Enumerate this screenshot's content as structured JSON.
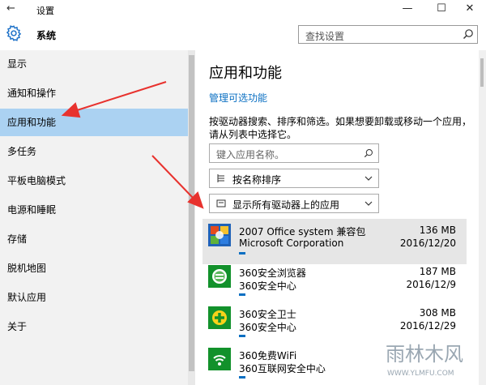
{
  "window": {
    "title": "设置",
    "back_glyph": "←",
    "minimize_glyph": "—",
    "maximize_glyph": "☐",
    "close_glyph": "✕"
  },
  "header": {
    "title": "系统",
    "search_placeholder": "查找设置"
  },
  "sidebar": {
    "items": [
      {
        "label": "显示"
      },
      {
        "label": "通知和操作"
      },
      {
        "label": "应用和功能",
        "selected": true
      },
      {
        "label": "多任务"
      },
      {
        "label": "平板电脑模式"
      },
      {
        "label": "电源和睡眠"
      },
      {
        "label": "存储"
      },
      {
        "label": "脱机地图"
      },
      {
        "label": "默认应用"
      },
      {
        "label": "关于"
      }
    ]
  },
  "main": {
    "title": "应用和功能",
    "manage_link": "管理可选功能",
    "description": "按驱动器搜索、排序和筛选。如果想要卸载或移动一个应用，请从列表中选择它。",
    "search_placeholder": "键入应用名称。",
    "sort_label": "按名称排序",
    "filter_label": "显示所有驱动器上的应用",
    "apps": [
      {
        "name": "2007 Office system 兼容包",
        "publisher": "Microsoft Corporation",
        "size": "136 MB",
        "date": "2016/12/20",
        "highlighted": true,
        "icon": "office-icon"
      },
      {
        "name": "360安全浏览器",
        "publisher": "360安全中心",
        "size": "187 MB",
        "date": "2016/12/9",
        "icon": "360-browser-icon"
      },
      {
        "name": "360安全卫士",
        "publisher": "360安全中心",
        "size": "308 MB",
        "date": "2016/12/29",
        "icon": "360-safe-icon"
      },
      {
        "name": "360免费WiFi",
        "publisher": "360互联网安全中心",
        "size": "",
        "date": "",
        "icon": "360-wifi-icon"
      }
    ]
  },
  "watermark": {
    "title": "雨林木风",
    "url": "WWW.YLMFU.COM"
  },
  "colors": {
    "selection": "#abd2f2",
    "link": "#0a6fc2",
    "sidebar_bg": "#f2f2f2",
    "arrow": "#e8322e",
    "app_icon_bg": "#12912b"
  }
}
